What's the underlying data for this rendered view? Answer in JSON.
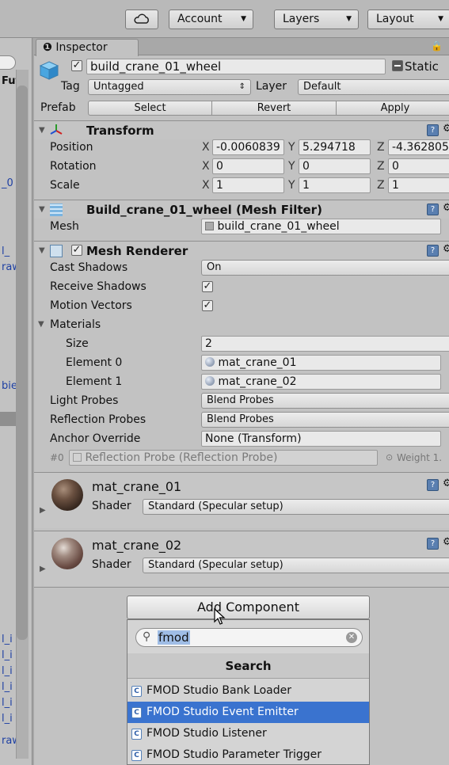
{
  "toolbar": {
    "account": "Account",
    "layers": "Layers",
    "layout": "Layout"
  },
  "left_fragments": [
    "Fut",
    "_0",
    "l_",
    "raw",
    "bie",
    "l_i",
    "l_i",
    "l_i",
    "l_i",
    "l_i",
    "l_i",
    "raw"
  ],
  "inspector": {
    "tab": "Inspector",
    "object_name": "build_crane_01_wheel",
    "static_label": "Static",
    "tag_label": "Tag",
    "tag_value": "Untagged",
    "layer_label": "Layer",
    "layer_value": "Default",
    "prefab_label": "Prefab",
    "prefab_select": "Select",
    "prefab_revert": "Revert",
    "prefab_apply": "Apply"
  },
  "transform": {
    "title": "Transform",
    "position_label": "Position",
    "rotation_label": "Rotation",
    "scale_label": "Scale",
    "pos_x": "-0.0060839",
    "pos_y": "5.294718",
    "pos_z": "-4.362805",
    "rot_x": "0",
    "rot_y": "0",
    "rot_z": "0",
    "scale_x": "1",
    "scale_y": "1",
    "scale_z": "1",
    "axis_x": "X",
    "axis_y": "Y",
    "axis_z": "Z"
  },
  "mesh_filter": {
    "title": "Build_crane_01_wheel (Mesh Filter)",
    "mesh_label": "Mesh",
    "mesh_value": "build_crane_01_wheel"
  },
  "mesh_renderer": {
    "title": "Mesh Renderer",
    "cast_shadows_label": "Cast Shadows",
    "cast_shadows_value": "On",
    "receive_shadows_label": "Receive Shadows",
    "motion_vectors_label": "Motion Vectors",
    "materials_label": "Materials",
    "size_label": "Size",
    "size_value": "2",
    "element0_label": "Element 0",
    "element0_value": "mat_crane_01",
    "element1_label": "Element 1",
    "element1_value": "mat_crane_02",
    "light_probes_label": "Light Probes",
    "light_probes_value": "Blend Probes",
    "reflection_probes_label": "Reflection Probes",
    "reflection_probes_value": "Blend Probes",
    "anchor_override_label": "Anchor Override",
    "anchor_override_value": "None (Transform)",
    "probe_index": "#0",
    "probe_value": "Reflection Probe (Reflection Probe)",
    "weight_label": "Weight 1."
  },
  "materials": [
    {
      "name": "mat_crane_01",
      "shader_label": "Shader",
      "shader_value": "Standard (Specular setup)"
    },
    {
      "name": "mat_crane_02",
      "shader_label": "Shader",
      "shader_value": "Standard (Specular setup)"
    }
  ],
  "add_component": {
    "button": "Add Component",
    "search_query": "fmod",
    "header": "Search",
    "items": [
      "FMOD Studio Bank Loader",
      "FMOD Studio Event Emitter",
      "FMOD Studio Listener",
      "FMOD Studio Parameter Trigger"
    ],
    "selected_index": 1
  },
  "colors": {
    "selection": "#3a73cf",
    "panel": "#c2c2c2"
  }
}
